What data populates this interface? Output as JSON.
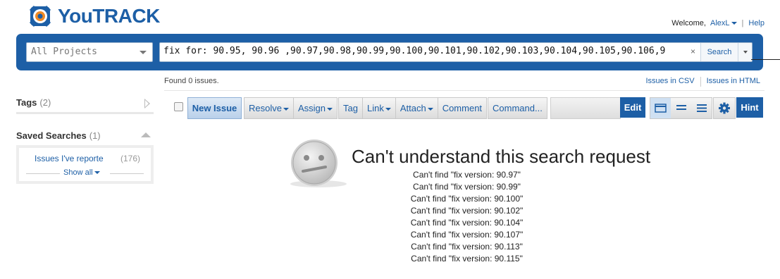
{
  "header": {
    "logo_text": "YouTRACK",
    "welcome_label": "Welcome,",
    "username": "AlexL",
    "help_label": "Help"
  },
  "search": {
    "project_placeholder": "All Projects",
    "query_keyword": "fix for:",
    "query_ok_part": " 90.95, 90.96 ,",
    "query_values": [
      "90.97",
      "90.98",
      "90.99",
      "90.100",
      "90.101",
      "90.102",
      "90.103",
      "90.104",
      "90.105",
      "90.106",
      "9"
    ],
    "search_button": "Search",
    "clear_icon": "close-icon"
  },
  "results": {
    "found_text": "Found 0 issues.",
    "csv_link": "Issues in CSV",
    "html_link": "Issues in HTML"
  },
  "sidebar": {
    "tags_label": "Tags",
    "tags_count": "(2)",
    "saved_label": "Saved Searches",
    "saved_count": "(1)",
    "saved_item_label": "Issues I've reporte",
    "saved_item_count": "(176)",
    "show_all": "Show all"
  },
  "toolbar": {
    "new_issue": "New Issue",
    "resolve": "Resolve",
    "assign": "Assign",
    "tag": "Tag",
    "link": "Link",
    "attach": "Attach",
    "comment": "Comment",
    "command": "Command...",
    "edit": "Edit",
    "hint": "Hint",
    "view_icons": [
      "detailed-view-icon",
      "compact-view-icon",
      "list-view-icon",
      "gear-icon"
    ]
  },
  "message": {
    "title": "Can't understand this search request",
    "lines": [
      "Can't find \"fix version: 90.97\"",
      "Can't find \"fix version: 90.99\"",
      "Can't find \"fix version: 90.100\"",
      "Can't find \"fix version: 90.102\"",
      "Can't find \"fix version: 90.104\"",
      "Can't find \"fix version: 90.107\"",
      "Can't find \"fix version: 90.113\"",
      "Can't find \"fix version: 90.115\""
    ]
  },
  "colors": {
    "brand_blue": "#1d5fa6",
    "error_underline": "#cc2222"
  }
}
